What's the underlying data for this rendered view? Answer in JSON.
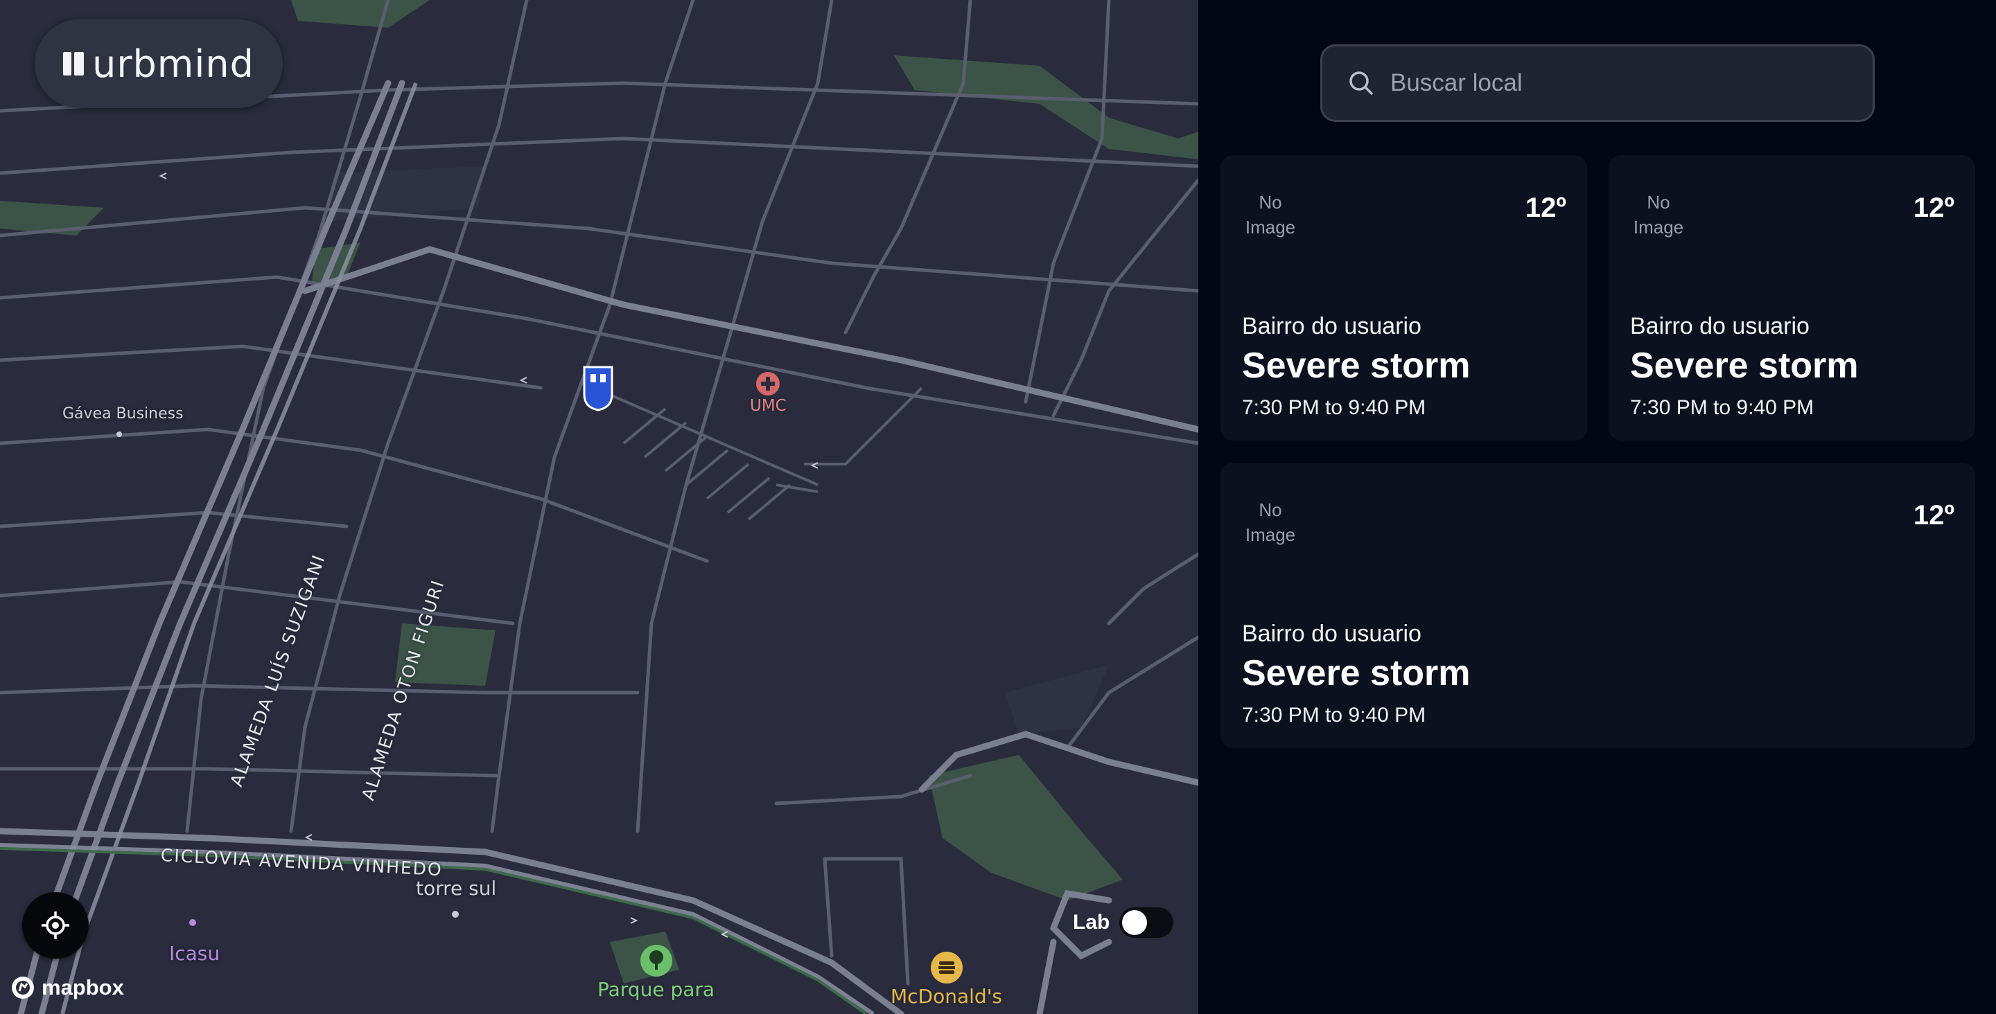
{
  "brand": {
    "name": "urbmind"
  },
  "map": {
    "labels": {
      "gavea": "Gávea Business",
      "umc": "UMC",
      "torre_sul": "torre sul",
      "icasu": "Icasu",
      "parque": "Parque para",
      "mcdonalds": "McDonald's"
    },
    "streets": {
      "alameda_luis": "ALAMEDA LUÍS SUZIGANI",
      "alameda_oton": "ALAMEDA OTON FIGURI",
      "ciclovia": "CICLOVIA AVENIDA VINHEDO"
    },
    "attribution": "mapbox",
    "lab_toggle": {
      "label": "Lab",
      "on": false
    },
    "colors": {
      "water": "#2a2c3d",
      "road": "#6e7386",
      "park": "#3c5447"
    }
  },
  "search": {
    "placeholder": "Buscar local",
    "value": ""
  },
  "cards": [
    {
      "image_placeholder": "No Image",
      "temperature": "12º",
      "neighborhood": "Bairro do usuario",
      "condition": "Severe storm",
      "time_range": "7:30 PM to 9:40 PM"
    },
    {
      "image_placeholder": "No Image",
      "temperature": "12º",
      "neighborhood": "Bairro do usuario",
      "condition": "Severe storm",
      "time_range": "7:30 PM to 9:40 PM"
    },
    {
      "image_placeholder": "No Image",
      "temperature": "12º",
      "neighborhood": "Bairro do usuario",
      "condition": "Severe storm",
      "time_range": "7:30 PM to 9:40 PM"
    }
  ],
  "icons": [
    "search-icon",
    "locate-icon",
    "mapbox-logo-icon",
    "hospital-icon",
    "park-icon",
    "restaurant-icon",
    "location-pin-icon"
  ]
}
